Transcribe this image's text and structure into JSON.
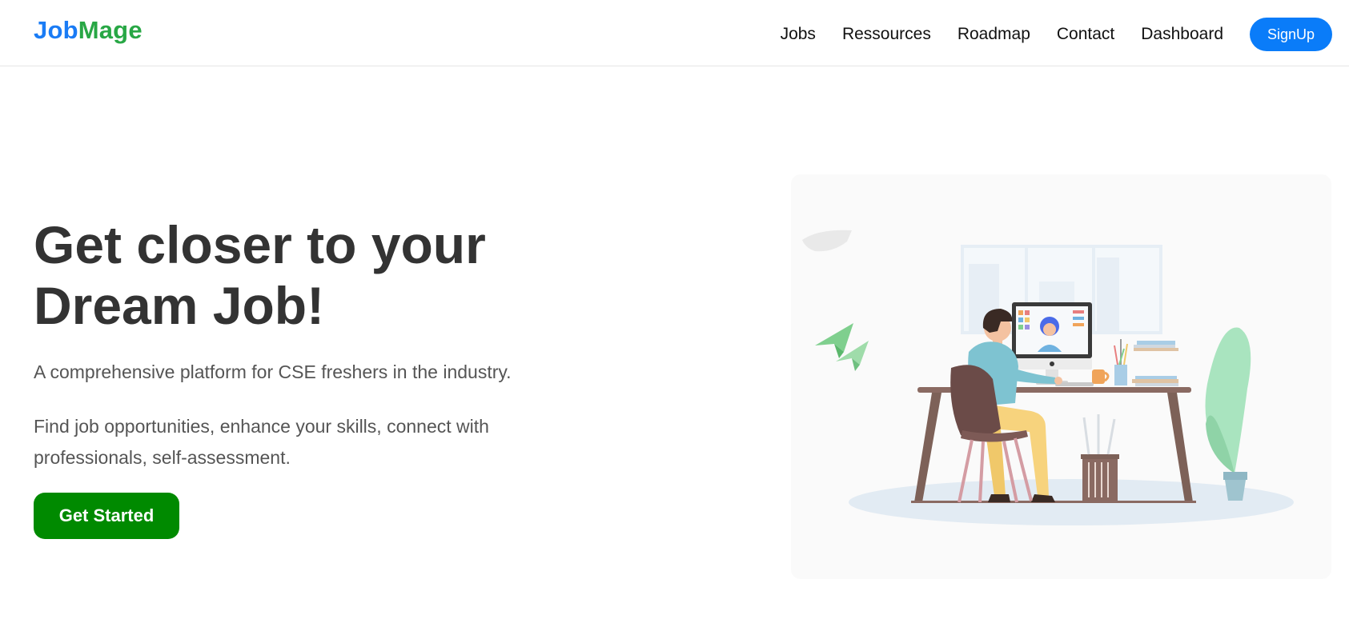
{
  "brand": {
    "part1": "Job",
    "part2": "Mage"
  },
  "nav": {
    "items": [
      {
        "label": "Jobs"
      },
      {
        "label": "Ressources"
      },
      {
        "label": "Roadmap"
      },
      {
        "label": "Contact"
      },
      {
        "label": "Dashboard"
      }
    ],
    "signup_label": "SignUp"
  },
  "hero": {
    "title_line1": "Get closer to your",
    "title_line2": "Dream Job!",
    "subtitle": "A comprehensive platform for CSE freshers in the industry.",
    "description": "Find job opportunities, enhance your skills, connect with professionals, self-assessment.",
    "cta_label": "Get Started"
  },
  "colors": {
    "brand_blue": "#1a7cf5",
    "brand_green": "#28a745",
    "signup_bg": "#0a7cf9",
    "cta_bg": "#008a00"
  },
  "icons": {
    "illustration": "person-working-at-desk-illustration"
  }
}
